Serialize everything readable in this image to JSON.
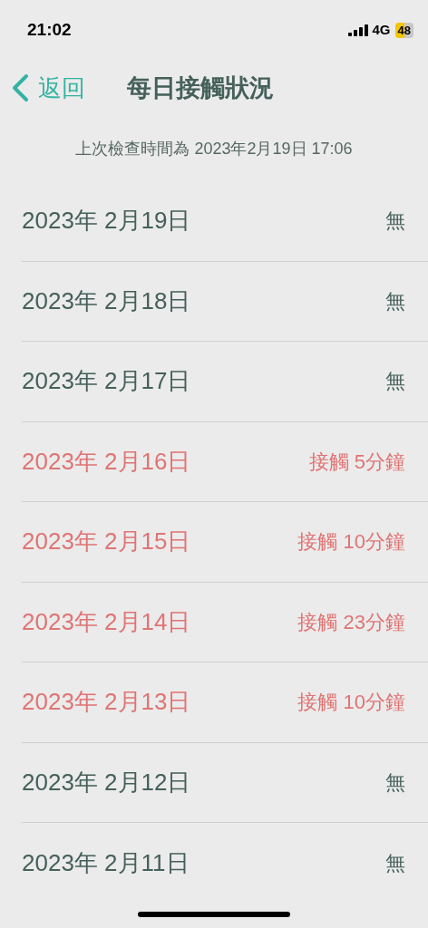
{
  "status_bar": {
    "time": "21:02",
    "network": "4G",
    "battery": "48"
  },
  "nav": {
    "back": "返回",
    "title": "每日接觸狀況"
  },
  "last_checked": "上次檢查時間為 2023年2月19日 17:06",
  "rows": [
    {
      "date": "2023年 2月19日",
      "result": "無",
      "kind": "none"
    },
    {
      "date": "2023年 2月18日",
      "result": "無",
      "kind": "none"
    },
    {
      "date": "2023年 2月17日",
      "result": "無",
      "kind": "none"
    },
    {
      "date": "2023年 2月16日",
      "result": "接觸 5分鐘",
      "kind": "contact"
    },
    {
      "date": "2023年 2月15日",
      "result": "接觸 10分鐘",
      "kind": "contact"
    },
    {
      "date": "2023年 2月14日",
      "result": "接觸 23分鐘",
      "kind": "contact"
    },
    {
      "date": "2023年 2月13日",
      "result": "接觸 10分鐘",
      "kind": "contact"
    },
    {
      "date": "2023年 2月12日",
      "result": "無",
      "kind": "none"
    },
    {
      "date": "2023年 2月11日",
      "result": "無",
      "kind": "none"
    }
  ]
}
